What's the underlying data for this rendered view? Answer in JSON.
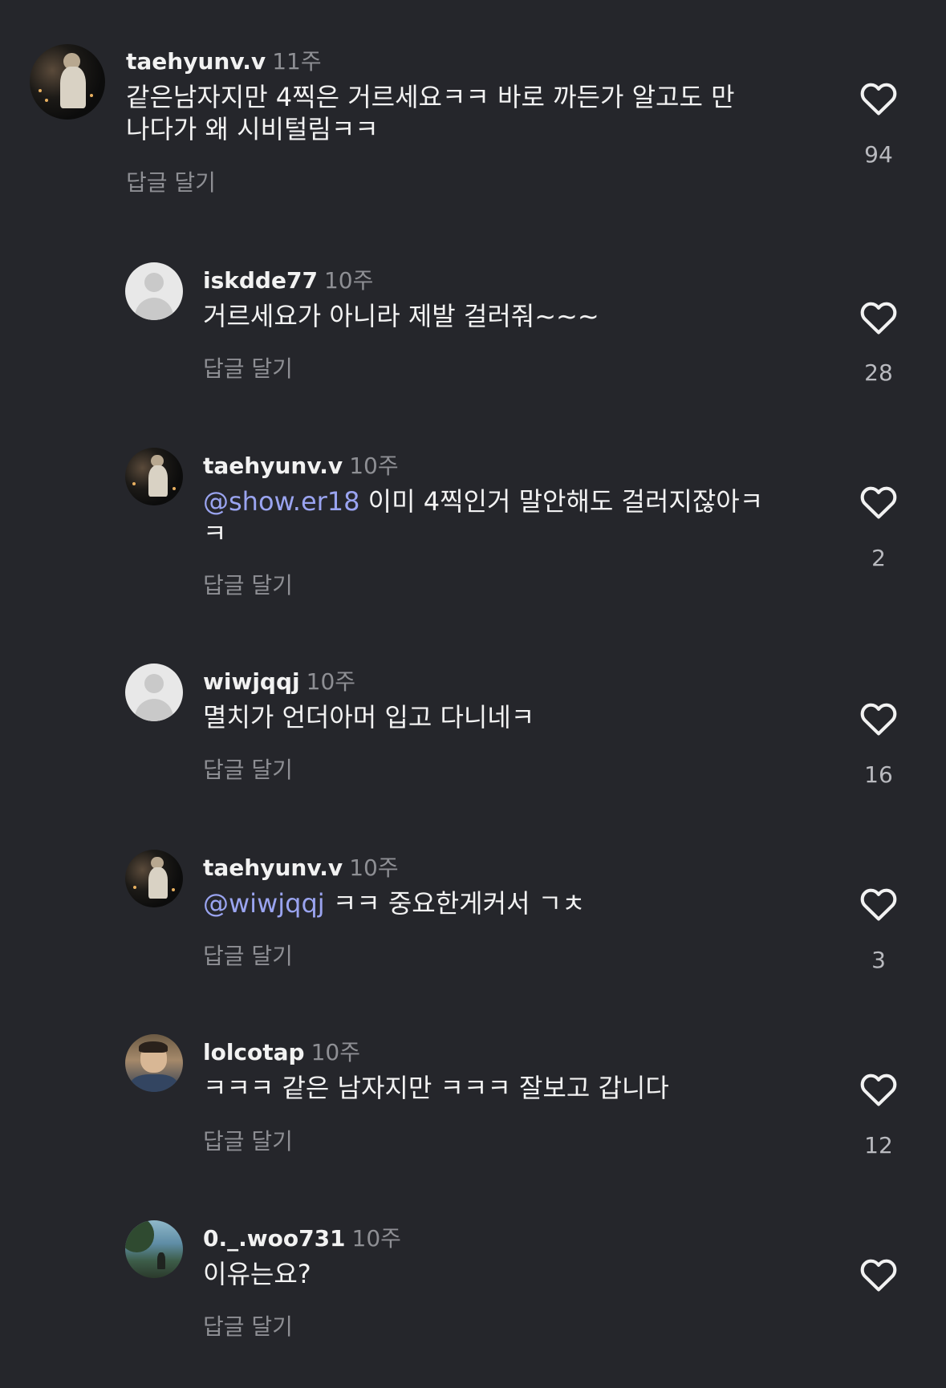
{
  "reply_label": "답글 달기",
  "comments": [
    {
      "username": "taehyunv.v",
      "time": "11주",
      "mention": "",
      "text": "같은남자지만 4찍은 거르세요ㅋㅋ 바로 까든가 알고도 만나다가 왜 시비털림ㅋㅋ",
      "likes": "94",
      "avatar": "night-photo"
    },
    {
      "username": "iskdde77",
      "time": "10주",
      "mention": "",
      "text": "거르세요가 아니라 제발 걸러줘~~~",
      "likes": "28",
      "avatar": "default-avatar"
    },
    {
      "username": "taehyunv.v",
      "time": "10주",
      "mention": "@show.er18",
      "text": " 이미 4찍인거 말안해도 걸러지잖아ㅋㅋ",
      "likes": "2",
      "avatar": "night-photo"
    },
    {
      "username": "wiwjqqj",
      "time": "10주",
      "mention": "",
      "text": "멸치가 언더아머 입고 다니네ㅋ",
      "likes": "16",
      "avatar": "default-avatar"
    },
    {
      "username": "taehyunv.v",
      "time": "10주",
      "mention": "@wiwjqqj",
      "text": " ㅋㅋ 중요한게커서 ㄱㅊ",
      "likes": "3",
      "avatar": "night-photo"
    },
    {
      "username": "lolcotap",
      "time": "10주",
      "mention": "",
      "text": "ㅋㅋㅋ 같은 남자지만 ㅋㅋㅋ 잘보고 갑니다",
      "likes": "12",
      "avatar": "person-photo"
    },
    {
      "username": "0._.woo731",
      "time": "10주",
      "mention": "",
      "text": "이유는요?",
      "likes": "",
      "avatar": "scenery-photo"
    }
  ],
  "icons": {
    "like": "heart-outline-icon"
  }
}
